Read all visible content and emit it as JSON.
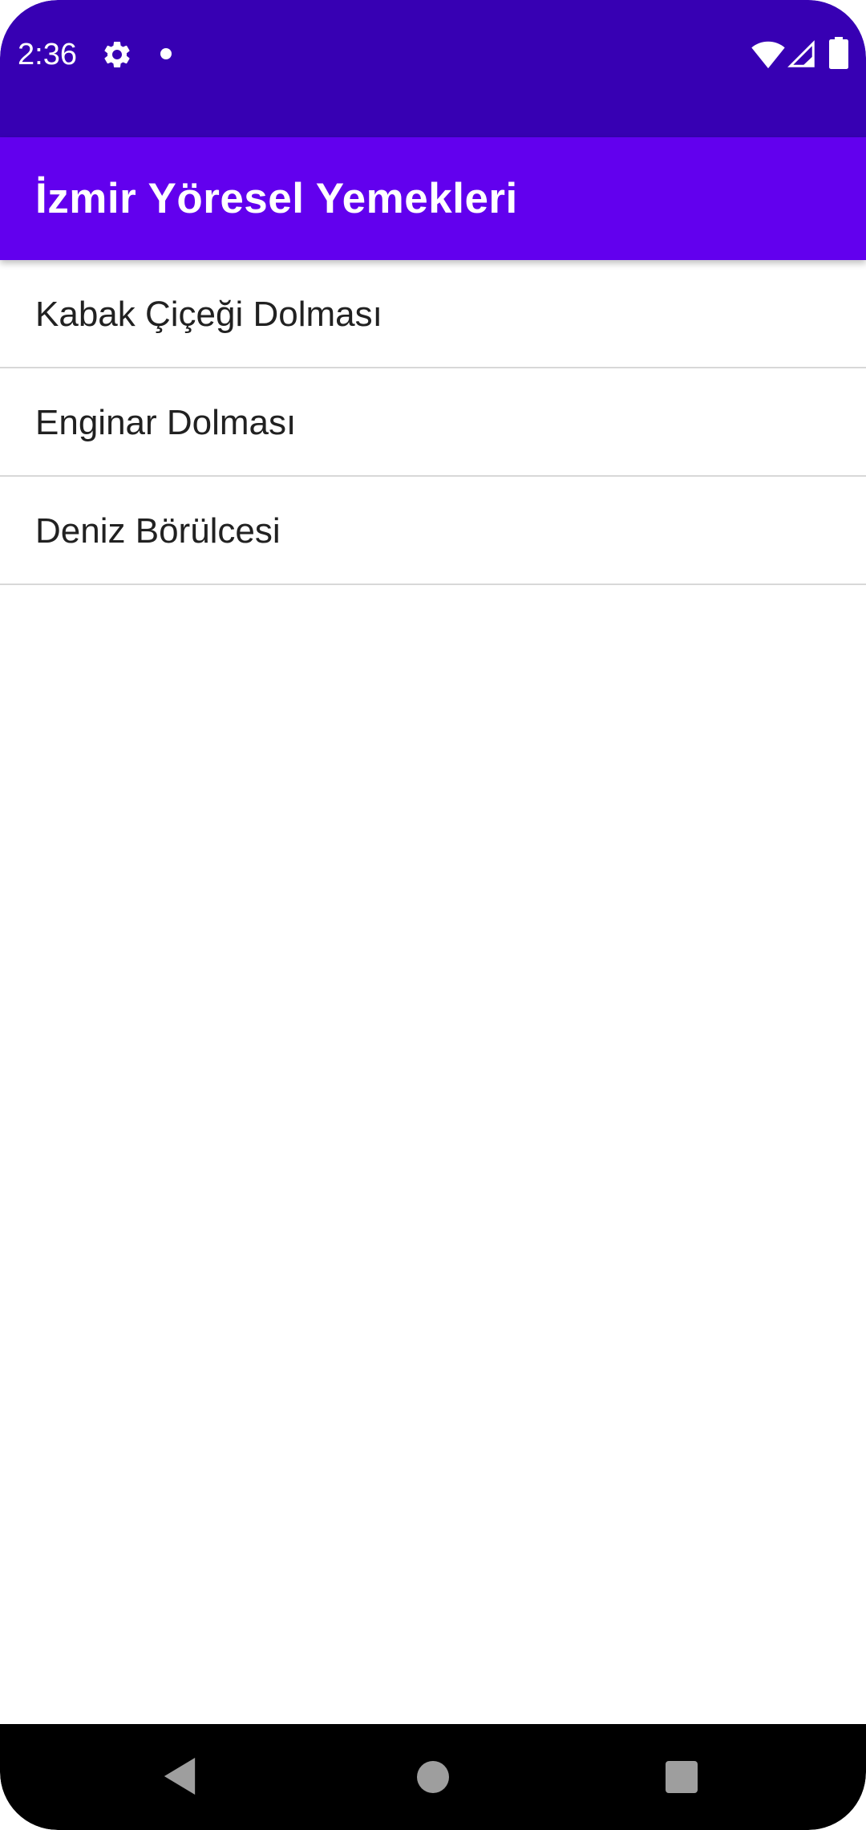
{
  "status_bar": {
    "time": "2:36",
    "icons": [
      "gear-icon",
      "notification-dot-icon",
      "wifi-icon",
      "cell-signal-icon",
      "battery-icon"
    ],
    "background": "#3700b3"
  },
  "app_bar": {
    "title": "İzmir Yöresel Yemekleri",
    "background": "#6200ee"
  },
  "list": {
    "items": [
      {
        "label": "Kabak Çiçeği Dolması"
      },
      {
        "label": "Enginar Dolması"
      },
      {
        "label": "Deniz Börülcesi"
      }
    ]
  },
  "nav_bar": {
    "icons": [
      "back-icon",
      "home-icon",
      "recents-icon"
    ]
  }
}
